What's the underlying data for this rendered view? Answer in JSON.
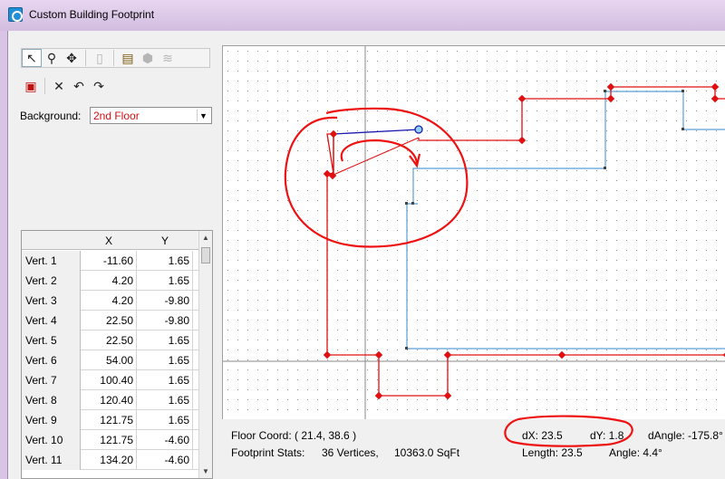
{
  "window": {
    "title": "Custom Building Footprint"
  },
  "toolbar": {
    "row1": [
      {
        "icon": "select-arrow-icon",
        "glyph": "↖",
        "pressed": true
      },
      {
        "icon": "zoom-icon",
        "glyph": "⚲"
      },
      {
        "icon": "pan-icon",
        "glyph": "✥"
      },
      {
        "icon": "dimension-icon",
        "glyph": "▯",
        "disabled": true
      },
      {
        "icon": "open-folder-icon",
        "glyph": "📂"
      },
      {
        "icon": "polygon-icon",
        "glyph": "⬢",
        "disabled": true
      },
      {
        "icon": "layers-icon",
        "glyph": "≋",
        "disabled": true
      }
    ],
    "row2": [
      {
        "icon": "window-icon",
        "glyph": "▣"
      },
      {
        "icon": "delete-icon",
        "glyph": "✕"
      },
      {
        "icon": "undo-icon",
        "glyph": "↶"
      },
      {
        "icon": "redo-icon",
        "glyph": "↷"
      }
    ]
  },
  "background": {
    "label": "Background:",
    "value": "2nd Floor"
  },
  "vertex_table": {
    "headers": [
      "",
      "X",
      "Y"
    ],
    "rows": [
      {
        "name": "Vert. 1",
        "x": "-11.60",
        "y": "1.65"
      },
      {
        "name": "Vert. 2",
        "x": "4.20",
        "y": "1.65"
      },
      {
        "name": "Vert. 3",
        "x": "4.20",
        "y": "-9.80"
      },
      {
        "name": "Vert. 4",
        "x": "22.50",
        "y": "-9.80"
      },
      {
        "name": "Vert. 5",
        "x": "22.50",
        "y": "1.65"
      },
      {
        "name": "Vert. 6",
        "x": "54.00",
        "y": "1.65"
      },
      {
        "name": "Vert. 7",
        "x": "100.40",
        "y": "1.65"
      },
      {
        "name": "Vert. 8",
        "x": "120.40",
        "y": "1.65"
      },
      {
        "name": "Vert. 9",
        "x": "121.75",
        "y": "1.65"
      },
      {
        "name": "Vert. 10",
        "x": "121.75",
        "y": "-4.60"
      },
      {
        "name": "Vert. 11",
        "x": "134.20",
        "y": "-4.60"
      }
    ]
  },
  "status": {
    "floor_coord": "Floor Coord: ( 21.4, 38.6 )",
    "footprint_label": "Footprint Stats:",
    "vertices": "36 Vertices,",
    "sqft": "10363.0 SqFt",
    "dx": "dX: 23.5",
    "dy": "dY: 1.8",
    "dangle": "dAngle: -175.8°",
    "length": "Length: 23.5",
    "angle": "Angle: 4.4°"
  },
  "colors": {
    "footprint_red": "#e01010",
    "background_blue": "#5a9fd4",
    "annotation_red": "#ee1111",
    "selection_blue": "#1a1ab0"
  }
}
